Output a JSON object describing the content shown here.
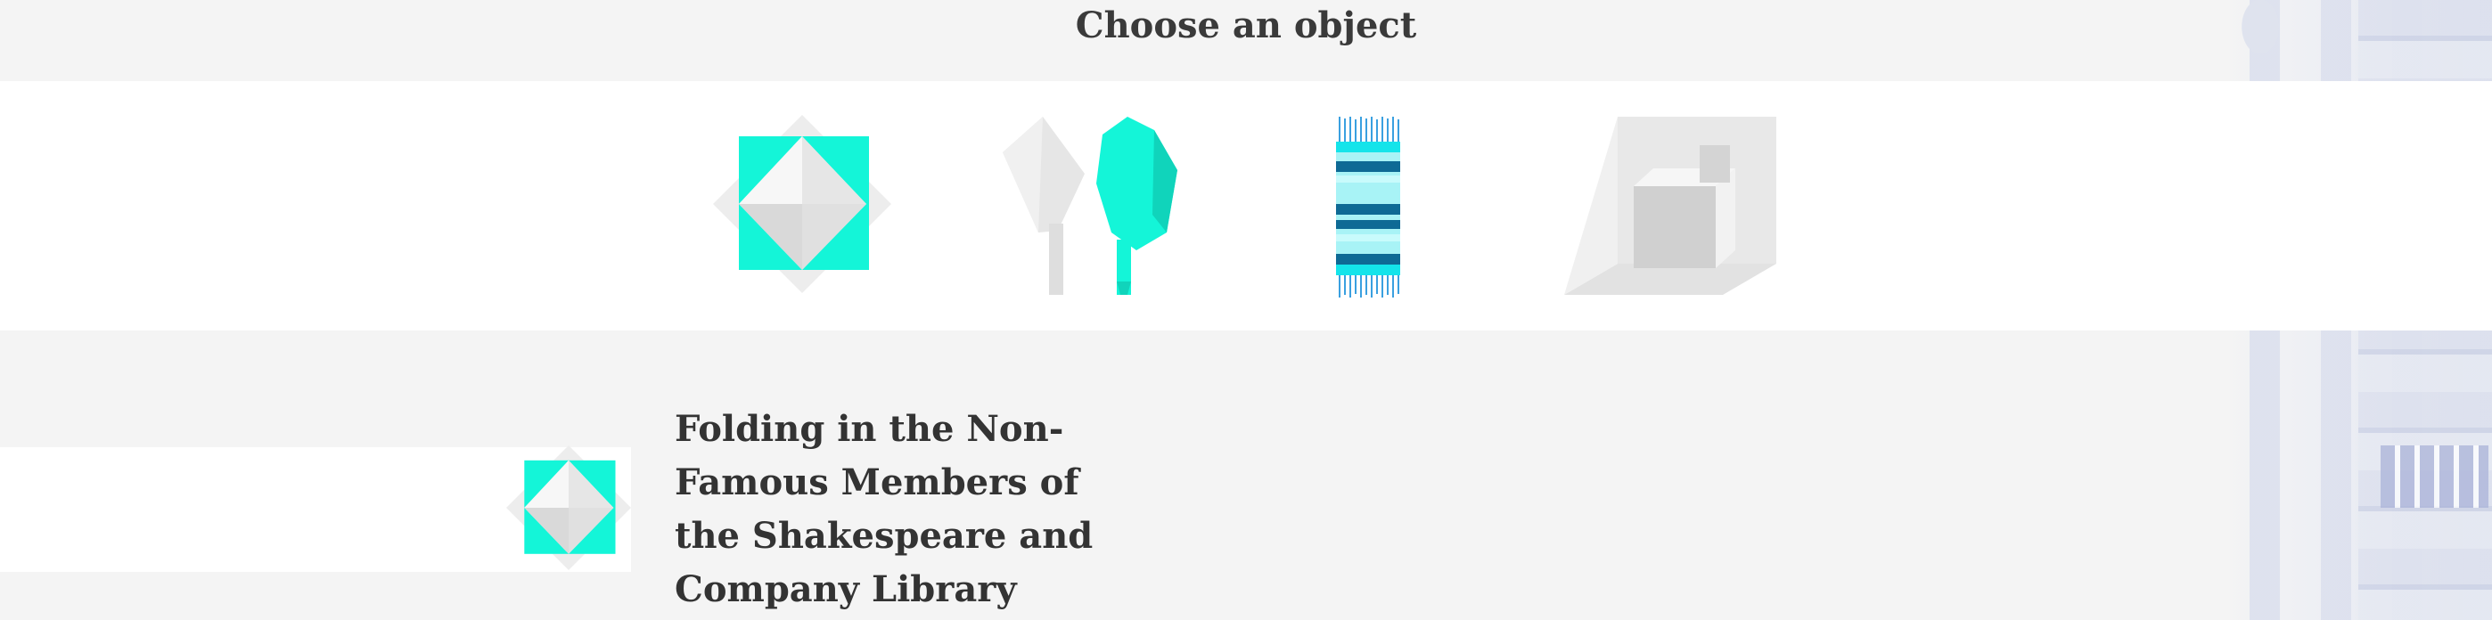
{
  "header": {
    "title": "Choose an object"
  },
  "objects": [
    {
      "name": "octahedron",
      "accent": "#14f5d8"
    },
    {
      "name": "trees",
      "accent": "#14f5d8"
    },
    {
      "name": "scarf",
      "accent": "#0e6a95"
    },
    {
      "name": "room",
      "accent": "#e8e8e8"
    }
  ],
  "story": {
    "title": "Folding in the Non-Famous Members of the Shakespeare and Company Library",
    "thumbnail": "octahedron-icon"
  },
  "colors": {
    "background": "#f4f4f4",
    "panel": "#ffffff",
    "accent": "#14f5d8",
    "text": "#333333"
  }
}
